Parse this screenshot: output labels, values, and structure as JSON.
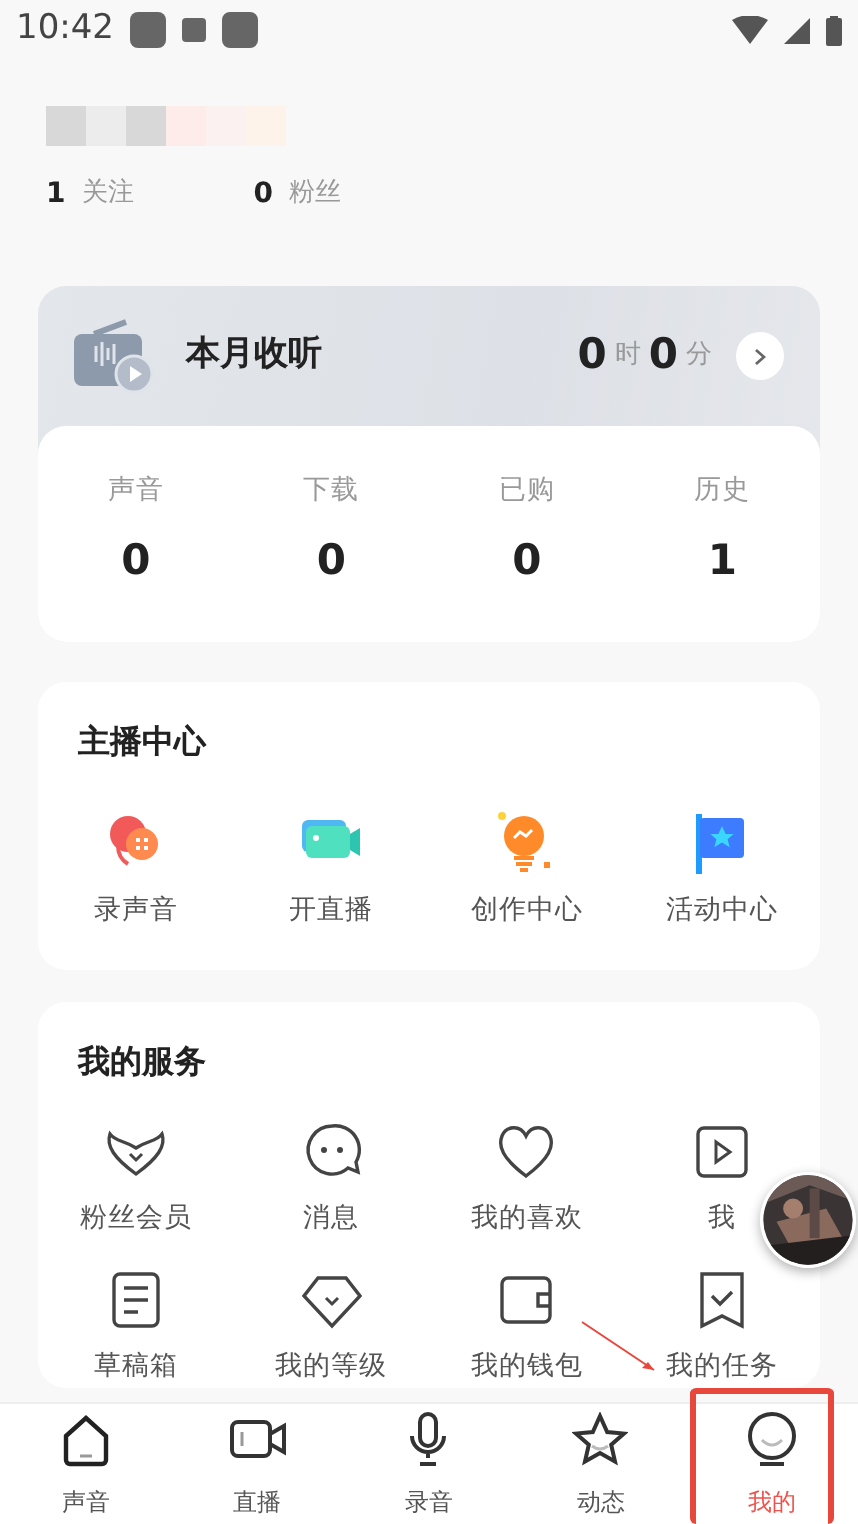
{
  "status_bar": {
    "time": "10:42"
  },
  "profile": {
    "follow_count": "1",
    "follow_label": "关注",
    "fan_count": "0",
    "fan_label": "粉丝"
  },
  "listening": {
    "title": "本月收听",
    "hours": "0",
    "hours_unit": "时",
    "minutes": "0",
    "minutes_unit": "分",
    "stats": [
      {
        "label": "声音",
        "value": "0"
      },
      {
        "label": "下载",
        "value": "0"
      },
      {
        "label": "已购",
        "value": "0"
      },
      {
        "label": "历史",
        "value": "1"
      }
    ]
  },
  "anchor_center": {
    "title": "主播中心",
    "items": [
      {
        "label": "录声音",
        "kind": "record"
      },
      {
        "label": "开直播",
        "kind": "live"
      },
      {
        "label": "创作中心",
        "kind": "bulb"
      },
      {
        "label": "活动中心",
        "kind": "flag"
      }
    ]
  },
  "services": {
    "title": "我的服务",
    "items": [
      {
        "label": "粉丝会员",
        "kind": "wings"
      },
      {
        "label": "消息",
        "kind": "chat"
      },
      {
        "label": "我的喜欢",
        "kind": "heart"
      },
      {
        "label": "我",
        "kind": "video"
      },
      {
        "label": "草稿箱",
        "kind": "doc"
      },
      {
        "label": "我的等级",
        "kind": "gem"
      },
      {
        "label": "我的钱包",
        "kind": "wallet"
      },
      {
        "label": "我的任务",
        "kind": "task"
      }
    ]
  },
  "tabs": [
    {
      "label": "声音",
      "kind": "home",
      "selected": false
    },
    {
      "label": "直播",
      "kind": "camera",
      "selected": false
    },
    {
      "label": "录音",
      "kind": "mic",
      "selected": false
    },
    {
      "label": "动态",
      "kind": "star",
      "selected": false
    },
    {
      "label": "我的",
      "kind": "face",
      "selected": true
    }
  ]
}
